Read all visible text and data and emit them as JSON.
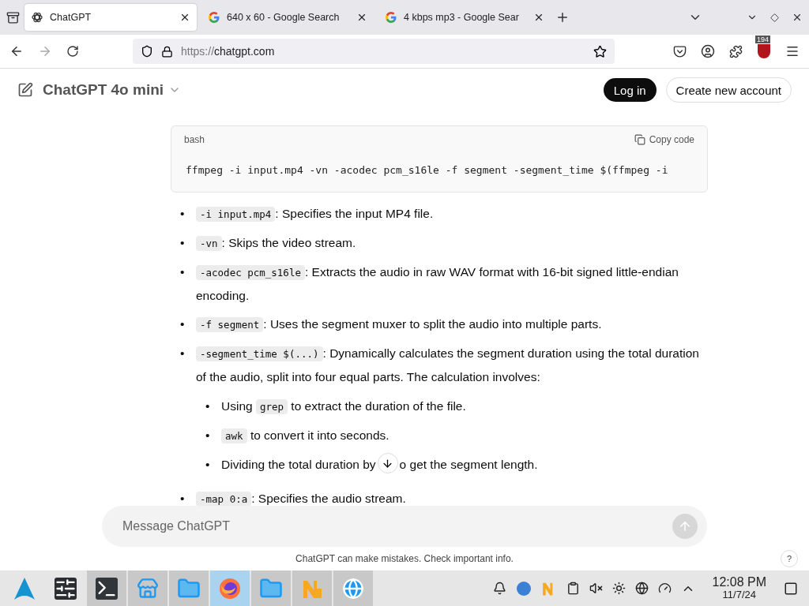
{
  "browser": {
    "tabs": [
      {
        "title": "ChatGPT",
        "selected": true,
        "kind": "chatgpt"
      },
      {
        "title": "640 x 60 - Google Search",
        "selected": false,
        "kind": "google"
      },
      {
        "title": "4 kbps mp3 - Google Sear",
        "selected": false,
        "kind": "google"
      }
    ],
    "url_scheme": "https://",
    "url_host": "chatgpt.com",
    "extension_badge": "194"
  },
  "header": {
    "model": "ChatGPT 4o mini",
    "login": "Log in",
    "signup": "Create new account"
  },
  "code_block": {
    "language": "bash",
    "copy": "Copy code",
    "code": "ffmpeg -i input.mp4 -vn -acodec pcm_s16le -f segment -segment_time $(ffmpeg -i"
  },
  "bullets": [
    {
      "marker": "•",
      "code": "-i input.mp4",
      "text": ": Specifies the input MP4 file."
    },
    {
      "marker": "•",
      "code": "-vn",
      "text": ": Skips the video stream."
    },
    {
      "marker": "•",
      "code": "-acodec pcm_s16le",
      "text": ": Extracts the audio in raw WAV format with 16-bit signed little-endian encoding."
    },
    {
      "marker": "•",
      "code": "-f segment",
      "text": ": Uses the segment muxer to split the audio into multiple parts."
    },
    {
      "marker": "•",
      "code": "-segment_time $(...)",
      "text": ": Dynamically calculates the segment duration using the total duration of the audio, split into four equal parts. The calculation involves:",
      "children": [
        {
          "marker": "•",
          "before": "Using ",
          "code": "grep",
          "text": " to extract the duration of the file."
        },
        {
          "marker": "•",
          "code": "awk",
          "text": " to convert it into seconds."
        },
        {
          "marker": "•",
          "before": "Dividing the total duration by",
          "text": "o get the segment length."
        }
      ]
    },
    {
      "marker": "•",
      "code": "-map 0:a",
      "text": ": Specifies the audio stream."
    }
  ],
  "composer": {
    "placeholder": "Message ChatGPT"
  },
  "disclaimer": "ChatGPT can make mistakes. Check important info.",
  "help": "?",
  "taskbar": {
    "apps": [
      {
        "kind": "launcher",
        "running": false,
        "selected": false
      },
      {
        "kind": "mixer",
        "running": false,
        "selected": false
      },
      {
        "kind": "terminal",
        "running": true,
        "selected": false
      },
      {
        "kind": "store",
        "running": true,
        "selected": false
      },
      {
        "kind": "folder",
        "running": true,
        "selected": false
      },
      {
        "kind": "firefox",
        "running": true,
        "selected": true
      },
      {
        "kind": "folder",
        "running": true,
        "selected": false
      },
      {
        "kind": "n",
        "running": true,
        "selected": false
      },
      {
        "kind": "globe",
        "running": true,
        "selected": false
      }
    ],
    "time": "12:08 PM",
    "date": "11/7/24"
  }
}
